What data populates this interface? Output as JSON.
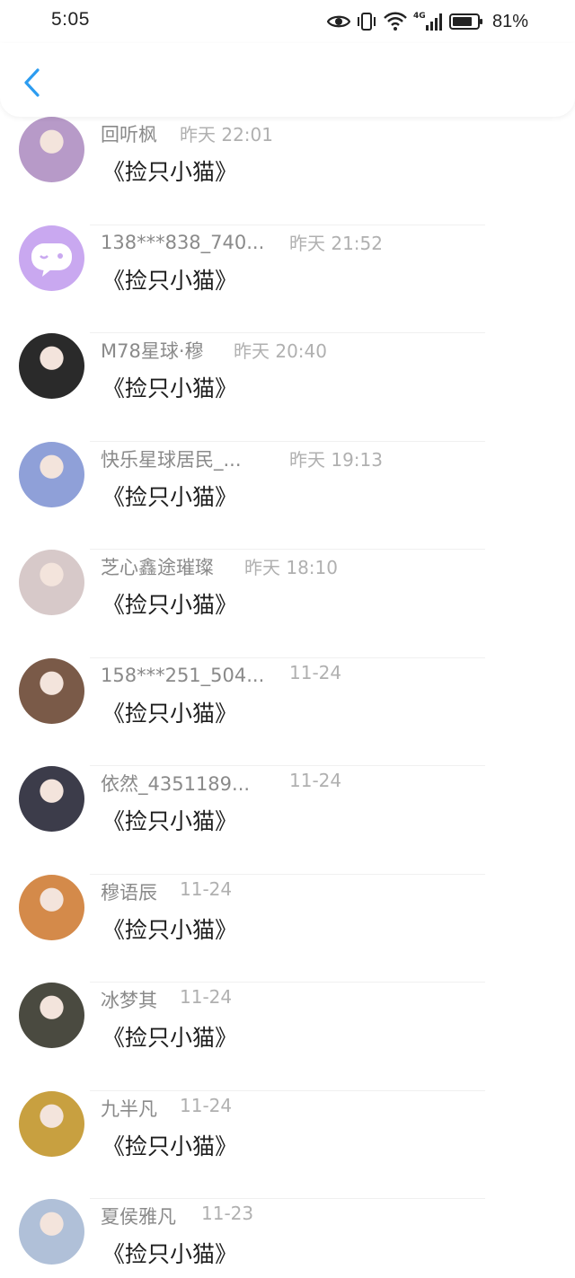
{
  "status_bar": {
    "time": "5:05",
    "battery_percent": "81%",
    "network": "4G",
    "icons": [
      "eye-icon",
      "vibrate-icon",
      "wifi-icon",
      "signal-icon",
      "battery-icon"
    ]
  },
  "nav": {
    "back_icon": "chevron-left-icon",
    "accent_color": "#2c9cf0"
  },
  "messages": [
    {
      "name": "回听枫",
      "time": "昨天 22:01",
      "text": "《捡只小猫》",
      "avatar_color": "#b79ac8"
    },
    {
      "name": "138***838_740...",
      "time": "昨天 21:52",
      "text": "《捡只小猫》",
      "avatar_color": "#c9a8f0"
    },
    {
      "name": "M78星球·穆",
      "time": "昨天 20:40",
      "text": "《捡只小猫》",
      "avatar_color": "#2a2a2a"
    },
    {
      "name": "快乐星球居民_...",
      "time": "昨天 19:13",
      "text": "《捡只小猫》",
      "avatar_color": "#8fa0d8"
    },
    {
      "name": "芝心鑫途璀璨",
      "time": "昨天 18:10",
      "text": "《捡只小猫》",
      "avatar_color": "#d7c9c9"
    },
    {
      "name": "158***251_504...",
      "time": "11-24",
      "text": "《捡只小猫》",
      "avatar_color": "#7a5a48"
    },
    {
      "name": "依然_4351189...",
      "time": "11-24",
      "text": "《捡只小猫》",
      "avatar_color": "#3c3c4a"
    },
    {
      "name": "穆语辰",
      "time": "11-24",
      "text": "《捡只小猫》",
      "avatar_color": "#d48a4a"
    },
    {
      "name": "冰梦其",
      "time": "11-24",
      "text": "《捡只小猫》",
      "avatar_color": "#4a4a40"
    },
    {
      "name": "九半凡",
      "time": "11-24",
      "text": "《捡只小猫》",
      "avatar_color": "#c8a040"
    },
    {
      "name": "夏侯雅凡",
      "time": "11-23",
      "text": "《捡只小猫》",
      "avatar_color": "#b0c0d8"
    }
  ]
}
